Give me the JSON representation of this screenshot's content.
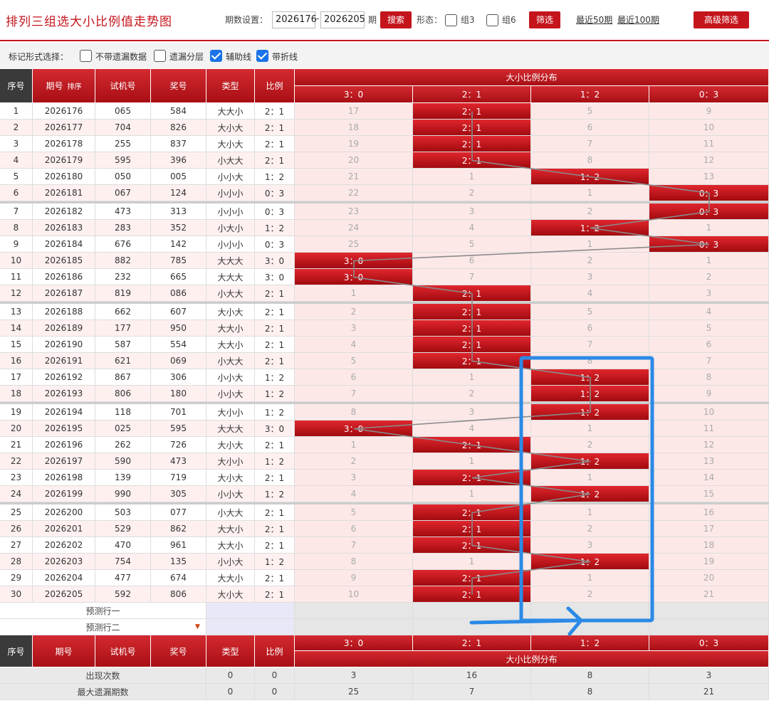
{
  "title": "排列三组选大小比例值走势图",
  "toolbar": {
    "period_label": "期数设置：",
    "from": "2026176",
    "dash": "-",
    "to": "2026205",
    "unit": "期",
    "search": "搜索",
    "form_label": "形态：",
    "group3": "组3",
    "group6": "组6",
    "filter": "筛选",
    "recent50": "最近50期",
    "recent100": "最近100期",
    "advanced": "高级筛选"
  },
  "markbar": {
    "label": "标记形式选择：",
    "opt1": "不带遗漏数据",
    "opt2": "遗漏分层",
    "opt3": "辅助线",
    "opt4": "带折线",
    "opt1_checked": false,
    "opt2_checked": false,
    "opt3_checked": true,
    "opt4_checked": true
  },
  "header": {
    "seq": "序号",
    "period": "期号",
    "sort": "排序",
    "test": "试机号",
    "award": "奖号",
    "type": "类型",
    "ratio": "比例",
    "dist": "大小比例分布",
    "cats": [
      "3：0",
      "2：1",
      "1：2",
      "0：3"
    ]
  },
  "rows": [
    {
      "seq": "1",
      "period": "2026176",
      "test": "065",
      "award": "584",
      "type": "大大小",
      "ratio": "2：1",
      "cells": [
        "17",
        "2：1",
        "5",
        "9"
      ]
    },
    {
      "seq": "2",
      "period": "2026177",
      "test": "704",
      "award": "826",
      "type": "大小大",
      "ratio": "2：1",
      "cells": [
        "18",
        "2：1",
        "6",
        "10"
      ]
    },
    {
      "seq": "3",
      "period": "2026178",
      "test": "255",
      "award": "837",
      "type": "大小大",
      "ratio": "2：1",
      "cells": [
        "19",
        "2：1",
        "7",
        "11"
      ]
    },
    {
      "seq": "4",
      "period": "2026179",
      "test": "595",
      "award": "396",
      "type": "小大大",
      "ratio": "2：1",
      "cells": [
        "20",
        "2：1",
        "8",
        "12"
      ]
    },
    {
      "seq": "5",
      "period": "2026180",
      "test": "050",
      "award": "005",
      "type": "小小大",
      "ratio": "1：2",
      "cells": [
        "21",
        "1",
        "1：2",
        "13"
      ]
    },
    {
      "seq": "6",
      "period": "2026181",
      "test": "067",
      "award": "124",
      "type": "小小小",
      "ratio": "0：3",
      "cells": [
        "22",
        "2",
        "1",
        "0：3"
      ]
    },
    {
      "seq": "7",
      "period": "2026182",
      "test": "473",
      "award": "313",
      "type": "小小小",
      "ratio": "0：3",
      "cells": [
        "23",
        "3",
        "2",
        "0：3"
      ]
    },
    {
      "seq": "8",
      "period": "2026183",
      "test": "283",
      "award": "352",
      "type": "小大小",
      "ratio": "1：2",
      "cells": [
        "24",
        "4",
        "1：2",
        "1"
      ]
    },
    {
      "seq": "9",
      "period": "2026184",
      "test": "676",
      "award": "142",
      "type": "小小小",
      "ratio": "0：3",
      "cells": [
        "25",
        "5",
        "1",
        "0：3"
      ]
    },
    {
      "seq": "10",
      "period": "2026185",
      "test": "882",
      "award": "785",
      "type": "大大大",
      "ratio": "3：0",
      "cells": [
        "3：0",
        "6",
        "2",
        "1"
      ]
    },
    {
      "seq": "11",
      "period": "2026186",
      "test": "232",
      "award": "665",
      "type": "大大大",
      "ratio": "3：0",
      "cells": [
        "3：0",
        "7",
        "3",
        "2"
      ]
    },
    {
      "seq": "12",
      "period": "2026187",
      "test": "819",
      "award": "086",
      "type": "小大大",
      "ratio": "2：1",
      "cells": [
        "1",
        "2：1",
        "4",
        "3"
      ]
    },
    {
      "seq": "13",
      "period": "2026188",
      "test": "662",
      "award": "607",
      "type": "大小大",
      "ratio": "2：1",
      "cells": [
        "2",
        "2：1",
        "5",
        "4"
      ]
    },
    {
      "seq": "14",
      "period": "2026189",
      "test": "177",
      "award": "950",
      "type": "大大小",
      "ratio": "2：1",
      "cells": [
        "3",
        "2：1",
        "6",
        "5"
      ]
    },
    {
      "seq": "15",
      "period": "2026190",
      "test": "587",
      "award": "554",
      "type": "大大小",
      "ratio": "2：1",
      "cells": [
        "4",
        "2：1",
        "7",
        "6"
      ]
    },
    {
      "seq": "16",
      "period": "2026191",
      "test": "621",
      "award": "069",
      "type": "小大大",
      "ratio": "2：1",
      "cells": [
        "5",
        "2：1",
        "8",
        "7"
      ]
    },
    {
      "seq": "17",
      "period": "2026192",
      "test": "867",
      "award": "306",
      "type": "小小大",
      "ratio": "1：2",
      "cells": [
        "6",
        "1",
        "1：2",
        "8"
      ]
    },
    {
      "seq": "18",
      "period": "2026193",
      "test": "806",
      "award": "180",
      "type": "小小大",
      "ratio": "1：2",
      "cells": [
        "7",
        "2",
        "1：2",
        "9"
      ]
    },
    {
      "seq": "19",
      "period": "2026194",
      "test": "118",
      "award": "701",
      "type": "大小小",
      "ratio": "1：2",
      "cells": [
        "8",
        "3",
        "1：2",
        "10"
      ]
    },
    {
      "seq": "20",
      "period": "2026195",
      "test": "025",
      "award": "595",
      "type": "大大大",
      "ratio": "3：0",
      "cells": [
        "3：0",
        "4",
        "1",
        "11"
      ]
    },
    {
      "seq": "21",
      "period": "2026196",
      "test": "262",
      "award": "726",
      "type": "大小大",
      "ratio": "2：1",
      "cells": [
        "1",
        "2：1",
        "2",
        "12"
      ]
    },
    {
      "seq": "22",
      "period": "2026197",
      "test": "590",
      "award": "473",
      "type": "大小小",
      "ratio": "1：2",
      "cells": [
        "2",
        "1",
        "1：2",
        "13"
      ]
    },
    {
      "seq": "23",
      "period": "2026198",
      "test": "139",
      "award": "719",
      "type": "大小大",
      "ratio": "2：1",
      "cells": [
        "3",
        "2：1",
        "1",
        "14"
      ]
    },
    {
      "seq": "24",
      "period": "2026199",
      "test": "990",
      "award": "305",
      "type": "小小大",
      "ratio": "1：2",
      "cells": [
        "4",
        "1",
        "1：2",
        "15"
      ]
    },
    {
      "seq": "25",
      "period": "2026200",
      "test": "503",
      "award": "077",
      "type": "小大大",
      "ratio": "2：1",
      "cells": [
        "5",
        "2：1",
        "1",
        "16"
      ]
    },
    {
      "seq": "26",
      "period": "2026201",
      "test": "529",
      "award": "862",
      "type": "大大小",
      "ratio": "2：1",
      "cells": [
        "6",
        "2：1",
        "2",
        "17"
      ]
    },
    {
      "seq": "27",
      "period": "2026202",
      "test": "470",
      "award": "961",
      "type": "大大小",
      "ratio": "2：1",
      "cells": [
        "7",
        "2：1",
        "3",
        "18"
      ]
    },
    {
      "seq": "28",
      "period": "2026203",
      "test": "754",
      "award": "135",
      "type": "小小大",
      "ratio": "1：2",
      "cells": [
        "8",
        "1",
        "1：2",
        "19"
      ]
    },
    {
      "seq": "29",
      "period": "2026204",
      "test": "477",
      "award": "674",
      "type": "大大小",
      "ratio": "2：1",
      "cells": [
        "9",
        "2：1",
        "1",
        "20"
      ]
    },
    {
      "seq": "30",
      "period": "2026205",
      "test": "592",
      "award": "806",
      "type": "大小大",
      "ratio": "2：1",
      "cells": [
        "10",
        "2：1",
        "2",
        "21"
      ]
    }
  ],
  "selected_col": [
    1,
    1,
    1,
    1,
    2,
    3,
    3,
    2,
    3,
    0,
    0,
    1,
    1,
    1,
    1,
    1,
    2,
    2,
    2,
    0,
    1,
    2,
    1,
    2,
    1,
    1,
    1,
    2,
    1,
    1
  ],
  "predict": {
    "row1": "预测行一",
    "row2": "预测行二"
  },
  "stats": [
    {
      "label": "出现次数",
      "type": "0",
      "ratio": "0",
      "values": [
        "3",
        "16",
        "8",
        "3"
      ]
    },
    {
      "label": "最大遗漏期数",
      "type": "0",
      "ratio": "0",
      "values": [
        "25",
        "7",
        "8",
        "21"
      ]
    }
  ],
  "colors": {
    "accent": "#c4151c",
    "highlight_box": "#2b8ae6"
  }
}
